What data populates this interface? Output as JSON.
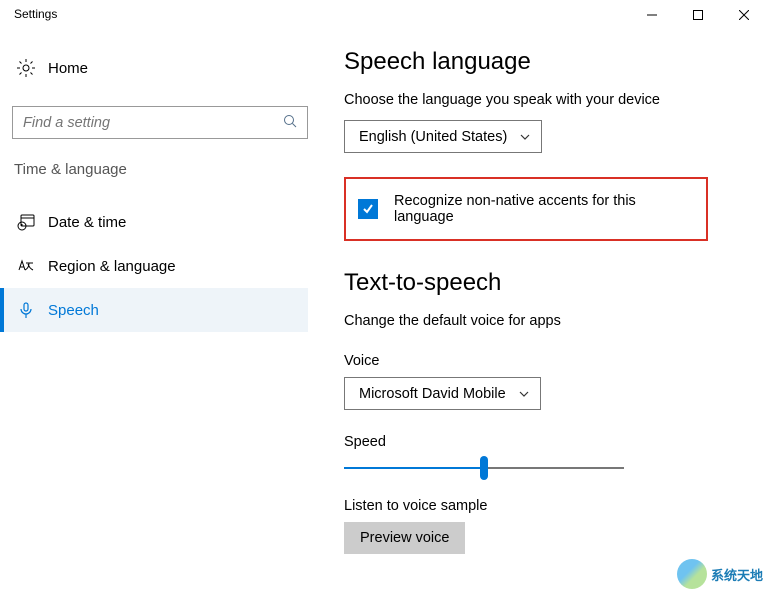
{
  "window": {
    "title": "Settings"
  },
  "sidebar": {
    "home": "Home",
    "search_placeholder": "Find a setting",
    "category": "Time & language",
    "items": [
      {
        "label": "Date & time"
      },
      {
        "label": "Region & language"
      },
      {
        "label": "Speech"
      }
    ]
  },
  "speech": {
    "heading": "Speech language",
    "desc": "Choose the language you speak with your device",
    "language_selected": "English (United States)",
    "accent_checkbox_label": "Recognize non-native accents for this language",
    "accent_checked": true
  },
  "tts": {
    "heading": "Text-to-speech",
    "desc": "Change the default voice for apps",
    "voice_label": "Voice",
    "voice_selected": "Microsoft David Mobile",
    "speed_label": "Speed",
    "speed_percent": 50,
    "listen_label": "Listen to voice sample",
    "preview_button": "Preview voice"
  },
  "watermark": "系统天地"
}
